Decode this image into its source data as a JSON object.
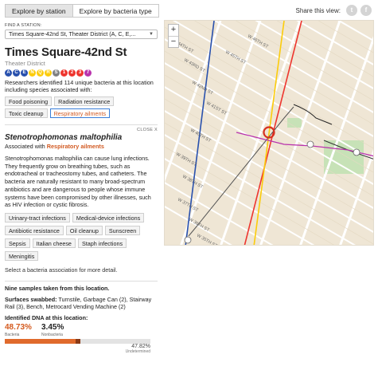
{
  "tabs": {
    "station": "Explore by station",
    "bacteria": "Explore by bacteria type"
  },
  "share": {
    "label": "Share this view:",
    "twitter": "t",
    "facebook": "f"
  },
  "finder": {
    "label": "FIND A STATION:",
    "value": "Times Square-42nd St, Theater District (A, C, E,...",
    "caret": "▼"
  },
  "station": {
    "title": "Times Square-42nd St",
    "district": "Theater District",
    "lines": [
      {
        "label": "A",
        "color": "#2850ad"
      },
      {
        "label": "C",
        "color": "#2850ad"
      },
      {
        "label": "E",
        "color": "#2850ad"
      },
      {
        "label": "N",
        "color": "#fccc0a"
      },
      {
        "label": "Q",
        "color": "#fccc0a"
      },
      {
        "label": "R",
        "color": "#fccc0a"
      },
      {
        "label": "S",
        "color": "#808183"
      },
      {
        "label": "1",
        "color": "#ee352e"
      },
      {
        "label": "2",
        "color": "#ee352e"
      },
      {
        "label": "3",
        "color": "#ee352e"
      },
      {
        "label": "7",
        "color": "#b933ad"
      }
    ],
    "intro": "Researchers identified 114 unique bacteria at this location including species associated with:"
  },
  "associations": [
    "Food poisoning",
    "Radiation resistance",
    "Toxic cleanup",
    "Respiratory ailments"
  ],
  "detail": {
    "close": "CLOSE X",
    "name": "Stenotrophomonas maltophilia",
    "assoc_prefix": "Associated with ",
    "assoc_value": "Respiratory ailments",
    "description": "Stenotrophomonas maltophilia can cause lung infections. They frequently grow on breathing tubes, such as endotracheal or tracheostomy tubes, and catheters. The bacteria are naturally resistant to many broad-spectrum antibiotics and are dangerous to people whose immune systems have been compromised by other illnesses, such as HIV infection or cystic fibrosis."
  },
  "illnesses": [
    "Urinary-tract infections",
    "Medical-device infections",
    "Antibiotic resistance",
    "Oil cleanup",
    "Sunscreen",
    "Sepsis",
    "Italian cheese",
    "Staph infections",
    "Meningitis"
  ],
  "note": "Select a bacteria association for more detail.",
  "samples": {
    "title": "Nine samples taken from this location.",
    "surfaces_label": "Surfaces swabbed:",
    "surfaces_value": " Turnstile, Garbage Can (2), Stairway Rail (3), Bench, Metrocard Vending Machine (2)"
  },
  "dna": {
    "title": "Identified DNA at this location:",
    "bacteria_pct": "48.73%",
    "bacteria_label": "Bacteria",
    "nonbacteria_pct": "3.45%",
    "nonbacteria_label": "Nonbacteria",
    "undetermined_pct": "47.82%",
    "undetermined_label": "Undetermined",
    "bacteria_value": 48.73,
    "nonbacteria_value": 3.45
  },
  "map": {
    "zoom_in": "+",
    "zoom_out": "−",
    "streets": [
      "W 44TH ST",
      "W 43RD ST",
      "W 42ND ST",
      "W 41ST ST",
      "W 40TH ST",
      "W 39TH ST",
      "W 38TH ST",
      "W 37TH ST",
      "W 36TH ST",
      "W 35TH ST",
      "W 46TH ST",
      "W 45TH ST"
    ]
  }
}
